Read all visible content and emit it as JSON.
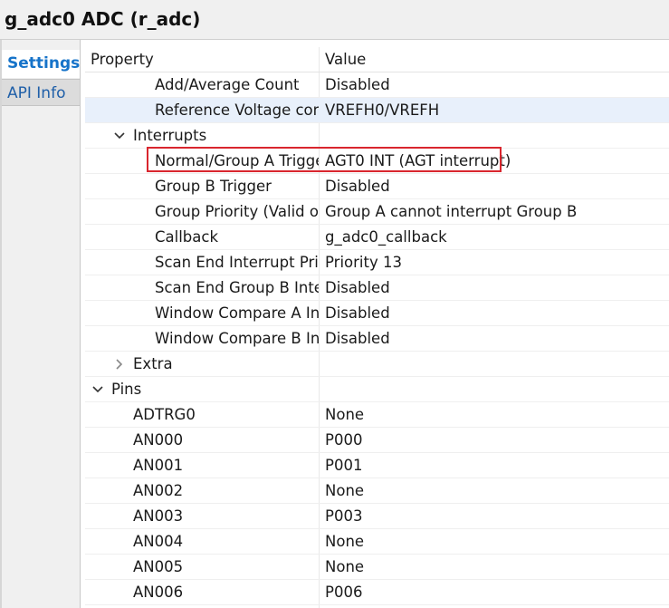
{
  "window": {
    "title": "g_adc0 ADC (r_adc)"
  },
  "tabs": [
    {
      "label": "Settings",
      "active": true
    },
    {
      "label": "API Info",
      "active": false
    }
  ],
  "table": {
    "header": {
      "property": "Property",
      "value": "Value"
    },
    "rows": [
      {
        "property": "Add/Average Count",
        "value": "Disabled"
      },
      {
        "property": "Reference Voltage cont",
        "value": "VREFH0/VREFH",
        "selected": true
      },
      {
        "property": "Interrupts",
        "value": "",
        "expanded": true
      },
      {
        "property": "Normal/Group A Trigge",
        "value": "AGT0 INT (AGT interrupt)",
        "highlighted": true
      },
      {
        "property": "Group B Trigger",
        "value": "Disabled"
      },
      {
        "property": "Group Priority (Valid or",
        "value": "Group A cannot interrupt Group B"
      },
      {
        "property": "Callback",
        "value": "g_adc0_callback"
      },
      {
        "property": "Scan End Interrupt Prio",
        "value": "Priority 13"
      },
      {
        "property": "Scan End Group B Inter",
        "value": "Disabled"
      },
      {
        "property": "Window Compare A Int",
        "value": "Disabled"
      },
      {
        "property": "Window Compare B Int",
        "value": "Disabled"
      },
      {
        "property": "Extra",
        "value": "",
        "expanded": false
      },
      {
        "property": "Pins",
        "value": "",
        "expanded": true
      },
      {
        "property": "ADTRG0",
        "value": "None"
      },
      {
        "property": "AN000",
        "value": "P000"
      },
      {
        "property": "AN001",
        "value": "P001"
      },
      {
        "property": "AN002",
        "value": "None"
      },
      {
        "property": "AN003",
        "value": "P003"
      },
      {
        "property": "AN004",
        "value": "None"
      },
      {
        "property": "AN005",
        "value": "None"
      },
      {
        "property": "AN006",
        "value": "P006"
      }
    ]
  },
  "icons": {
    "expanded": "chevron-down-icon",
    "collapsed": "chevron-right-icon"
  },
  "colors": {
    "active_tab_text": "#1673c9",
    "selected_row": "#e8f0fb",
    "highlight_border": "#d9262e"
  }
}
